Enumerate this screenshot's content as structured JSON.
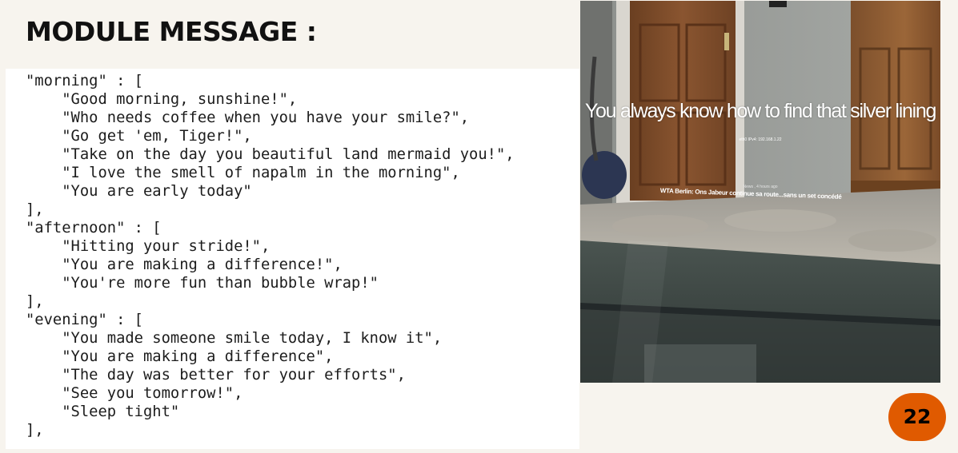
{
  "slide": {
    "title": "MODULE MESSAGE :",
    "page_number": "22"
  },
  "code": {
    "text": "\"morning\" : [\n    \"Good morning, sunshine!\",\n    \"Who needs coffee when you have your smile?\",\n    \"Go get 'em, Tiger!\",\n    \"Take on the day you beautiful land mermaid you!\",\n    \"I love the smell of napalm in the morning\",\n    \"You are early today\"\n],\n\"afternoon\" : [\n    \"Hitting your stride!\",\n    \"You are making a difference!\",\n    \"You're more fun than bubble wrap!\"\n],\n\"evening\" : [\n    \"You made someone smile today, I know it\",\n    \"You are making a difference\",\n    \"The day was better for your efforts\",\n    \"See you tomorrow!\",\n    \"Sleep tight\"\n],"
  },
  "mirror": {
    "message": "You always know how to find that silver lining",
    "ip_line": "eth0 IPv4: 192.168.1.22",
    "news_meta": "News , 4 hours ago",
    "news_headline": "WTA Berlin: Ons Jabeur continue sa route...sans un set concédé"
  },
  "colors": {
    "background": "#f7f4ee",
    "badge": "#e05a00",
    "code_panel": "#ffffff"
  }
}
